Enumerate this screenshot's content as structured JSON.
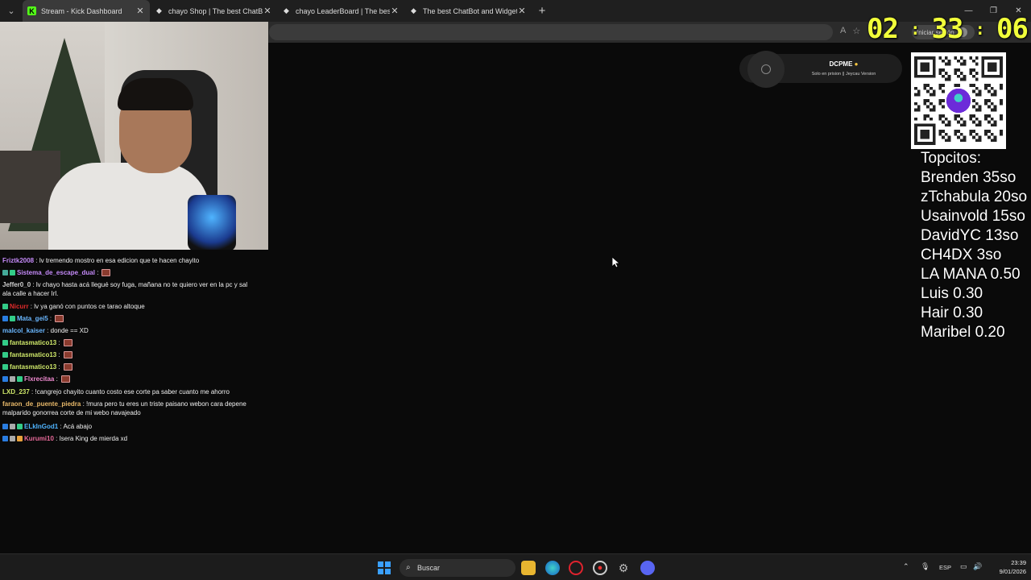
{
  "browser": {
    "tabs": [
      {
        "title": "Stream - Kick Dashboard",
        "icon": "kick-icon",
        "active": true
      },
      {
        "title": "chayo Shop | The best ChatBot an",
        "icon": "bot-icon",
        "active": false
      },
      {
        "title": "chayo LeaderBoard | The best Cha",
        "icon": "bot-icon",
        "active": false
      },
      {
        "title": "The best ChatBot and Widgets for",
        "icon": "bot-icon",
        "active": false
      }
    ],
    "signin_label": "Iniciar sesión"
  },
  "timer": {
    "hours": "02",
    "minutes": "33",
    "seconds": "06"
  },
  "chat": [
    {
      "user": "Friztk2008",
      "color": "#c58af9",
      "badges": [],
      "text": ": lv tremendo mostro en esa edicion que te hacen chayito",
      "emote": false
    },
    {
      "user": "Sistema_de_escape_dual",
      "color": "#c58af9",
      "badges": [
        "#4a9",
        "#3c8"
      ],
      "text": ":",
      "emote": true
    },
    {
      "user": "Jeffer0_0",
      "color": "#cfcfcf",
      "badges": [],
      "text": ": lv chayo hasta acá llegué soy fuga, mañana no te quiero ver en la pc y sal ala calle a hacer Irl.",
      "emote": false
    },
    {
      "user": "Nicurr",
      "color": "#e02a2a",
      "badges": [
        "#3c8"
      ],
      "text": ": lv ya ganó con puntos ce tarao altoque",
      "emote": false
    },
    {
      "user": "Mata_gei5",
      "color": "#6ab7ff",
      "badges": [
        "#2a7de1",
        "#3c8"
      ],
      "text": ":",
      "emote": true
    },
    {
      "user": "malcol_kaiser",
      "color": "#6ab7ff",
      "badges": [],
      "text": ": donde == XD",
      "emote": false
    },
    {
      "user": "fantasmatico13",
      "color": "#cfe86a",
      "badges": [
        "#3c8"
      ],
      "text": ":",
      "emote": true
    },
    {
      "user": "fantasmatico13",
      "color": "#cfe86a",
      "badges": [
        "#3c8"
      ],
      "text": ":",
      "emote": true
    },
    {
      "user": "fantasmatico13",
      "color": "#cfe86a",
      "badges": [
        "#3c8"
      ],
      "text": ":",
      "emote": true
    },
    {
      "user": "Flxrecitaa",
      "color": "#f08ad0",
      "badges": [
        "#2a7de1",
        "#aaa",
        "#3c8"
      ],
      "text": ":",
      "emote": true
    },
    {
      "user": "LXD_237",
      "color": "#cfe86a",
      "badges": [],
      "text": ": !cangrejo chayito cuanto costo ese corte pa saber cuanto me ahorro",
      "emote": false
    },
    {
      "user": "faraon_de_puente_piedra",
      "color": "#e8b96a",
      "badges": [],
      "text": ": !mura pero tu eres un triste paisano webon cara depene malparido gonorrea corte de mi webo navajeado",
      "emote": false
    },
    {
      "user": "ELkInGod1",
      "color": "#4fb4ff",
      "badges": [
        "#2a7de1",
        "#aaa",
        "#3c8"
      ],
      "text": ": Acá abajo",
      "emote": false
    },
    {
      "user": "Kurumi10",
      "color": "#e86a9a",
      "badges": [
        "#2a7de1",
        "#aaa",
        "#e8a23c"
      ],
      "text": ": Isera King de mierda xd",
      "emote": false
    }
  ],
  "now_playing": {
    "title": "DCPME",
    "subtitle": "Solo en prision || Jeycau Version"
  },
  "leaderboard": {
    "title": "Topcitos:",
    "entries": [
      "Brenden 35so",
      "zTchabula 20so",
      "Usainvold 15so",
      "DavidYC 13so",
      "CH4DX 3so",
      "LA MANA 0.50",
      "Luis 0.30",
      "Hair 0.30",
      "Maribel 0.20"
    ]
  },
  "taskbar": {
    "search_placeholder": "Buscar",
    "lang": "ESP",
    "time": "23:39",
    "date": "9/01/2026"
  }
}
